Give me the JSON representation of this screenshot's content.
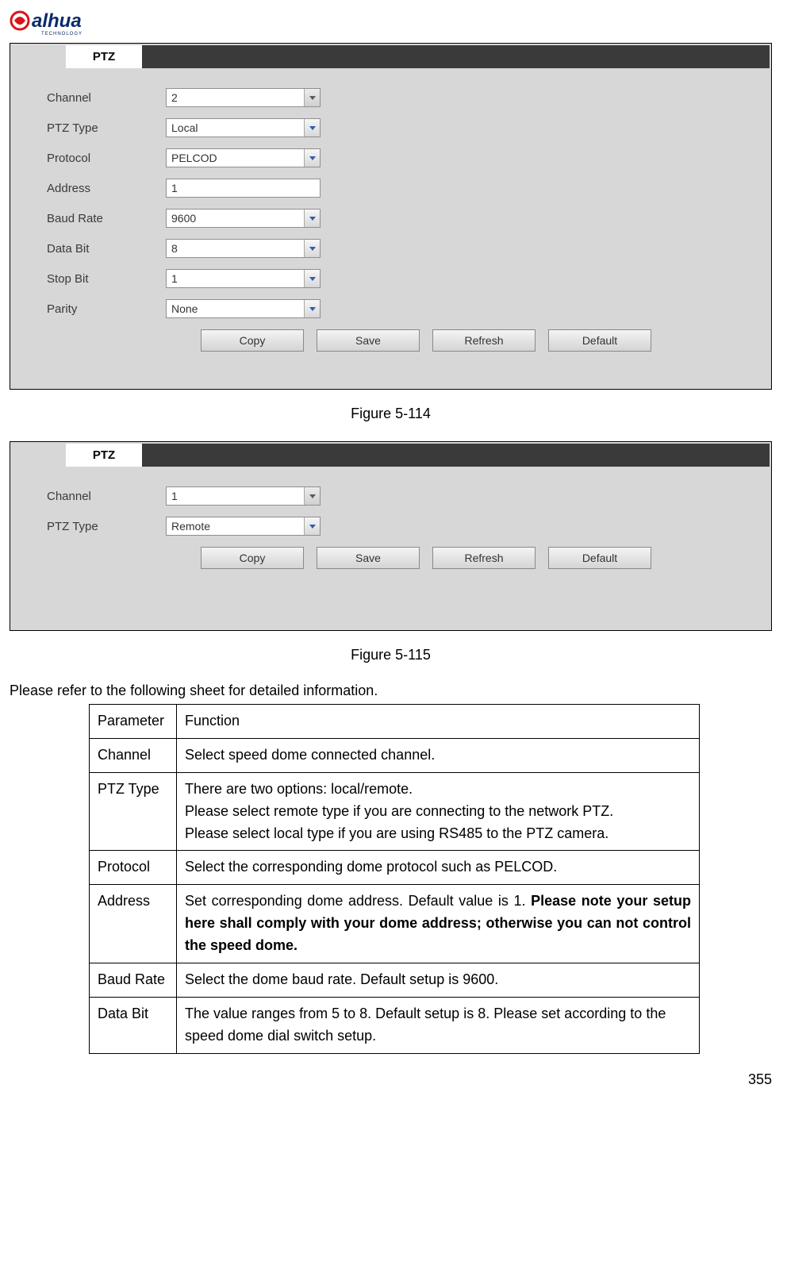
{
  "logo": {
    "brand": "alhua",
    "sub": "TECHNOLOGY"
  },
  "panel1": {
    "title": "PTZ",
    "rows": [
      {
        "label": "Channel",
        "value": "2",
        "type": "select",
        "disabled": true
      },
      {
        "label": "PTZ Type",
        "value": "Local",
        "type": "select"
      },
      {
        "label": "Protocol",
        "value": "PELCOD",
        "type": "select"
      },
      {
        "label": "Address",
        "value": "1",
        "type": "text"
      },
      {
        "label": "Baud Rate",
        "value": "9600",
        "type": "select"
      },
      {
        "label": "Data Bit",
        "value": "8",
        "type": "select"
      },
      {
        "label": "Stop Bit",
        "value": "1",
        "type": "select"
      },
      {
        "label": "Parity",
        "value": "None",
        "type": "select"
      }
    ],
    "buttons": [
      "Copy",
      "Save",
      "Refresh",
      "Default"
    ]
  },
  "caption1": "Figure 5-114",
  "panel2": {
    "title": "PTZ",
    "rows": [
      {
        "label": "Channel",
        "value": "1",
        "type": "select",
        "disabled": true
      },
      {
        "label": "PTZ Type",
        "value": "Remote",
        "type": "select"
      }
    ],
    "buttons": [
      "Copy",
      "Save",
      "Refresh",
      "Default"
    ]
  },
  "caption2": "Figure 5-115",
  "intro": "Please refer to the following sheet for detailed information.",
  "tableHeader": {
    "c1": "Parameter",
    "c2": "Function"
  },
  "tableRows": {
    "r1": {
      "p": "Channel",
      "f": "Select speed dome connected channel."
    },
    "r2": {
      "p": "PTZ Type",
      "l1": "There are two options: local/remote.",
      "l2": "Please select remote type if you are connecting to the network PTZ.",
      "l3": "Please select local type if you are using RS485 to the PTZ camera."
    },
    "r3": {
      "p": "Protocol",
      "f": "Select the corresponding dome protocol such as PELCOD."
    },
    "r4": {
      "p": "Address",
      "pre": "Set corresponding dome address. Default value is 1. ",
      "bold": "Please note your setup here shall comply with your dome address; otherwise you can not control the speed dome."
    },
    "r5": {
      "p": "Baud Rate",
      "f": "Select the dome baud rate. Default setup is 9600."
    },
    "r6": {
      "p": "Data Bit",
      "f": "The value ranges from 5 to 8. Default setup is 8. Please set according to the speed dome dial switch setup."
    }
  },
  "pageNumber": "355"
}
